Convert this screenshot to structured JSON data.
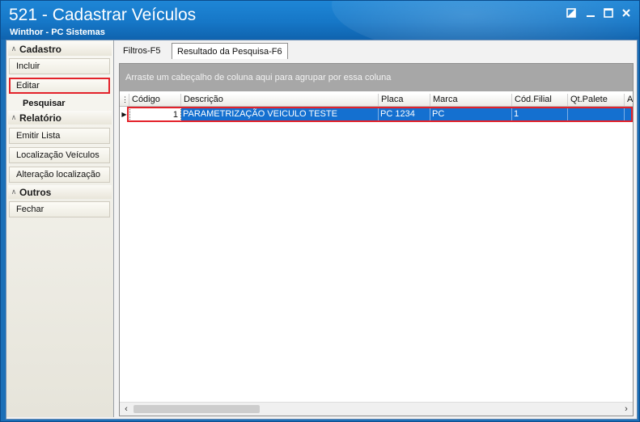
{
  "window": {
    "title": "521 - Cadastrar Veículos",
    "subtitle": "Winthor - PC Sistemas",
    "controls": {
      "restore": "restore-icon",
      "minimize": "minimize-icon",
      "maximize": "maximize-icon",
      "close": "close-icon"
    }
  },
  "sidebar": {
    "groups": [
      {
        "label": "Cadastro",
        "items": [
          "Incluir",
          "Editar"
        ],
        "sublabel": "Pesquisar"
      },
      {
        "label": "Relatório",
        "items": [
          "Emitir Lista",
          "Localização Veículos",
          "Alteração localização"
        ]
      },
      {
        "label": "Outros",
        "items": [
          "Fechar"
        ]
      }
    ],
    "highlighted_item": "Editar"
  },
  "tabs": [
    {
      "label": "Filtros-F5",
      "active": false
    },
    {
      "label": "Resultado da Pesquisa-F6",
      "active": true
    }
  ],
  "grid": {
    "group_hint": "Arraste um cabeçalho de coluna aqui para agrupar por essa coluna",
    "columns": [
      "Código",
      "Descrição",
      "Placa",
      "Marca",
      "Cód.Filial",
      "Qt.Palete",
      "A"
    ],
    "rows": [
      [
        "1",
        "PARAMETRIZAÇÃO VEICULO TESTE",
        "PC 1234",
        "PC",
        "1",
        "",
        ""
      ]
    ],
    "selected_row": 0
  },
  "colors": {
    "title_bar": "#1677c7",
    "selection": "#1470d0",
    "highlight_border": "#e3222a",
    "group_bar": "#a7a7a7"
  }
}
